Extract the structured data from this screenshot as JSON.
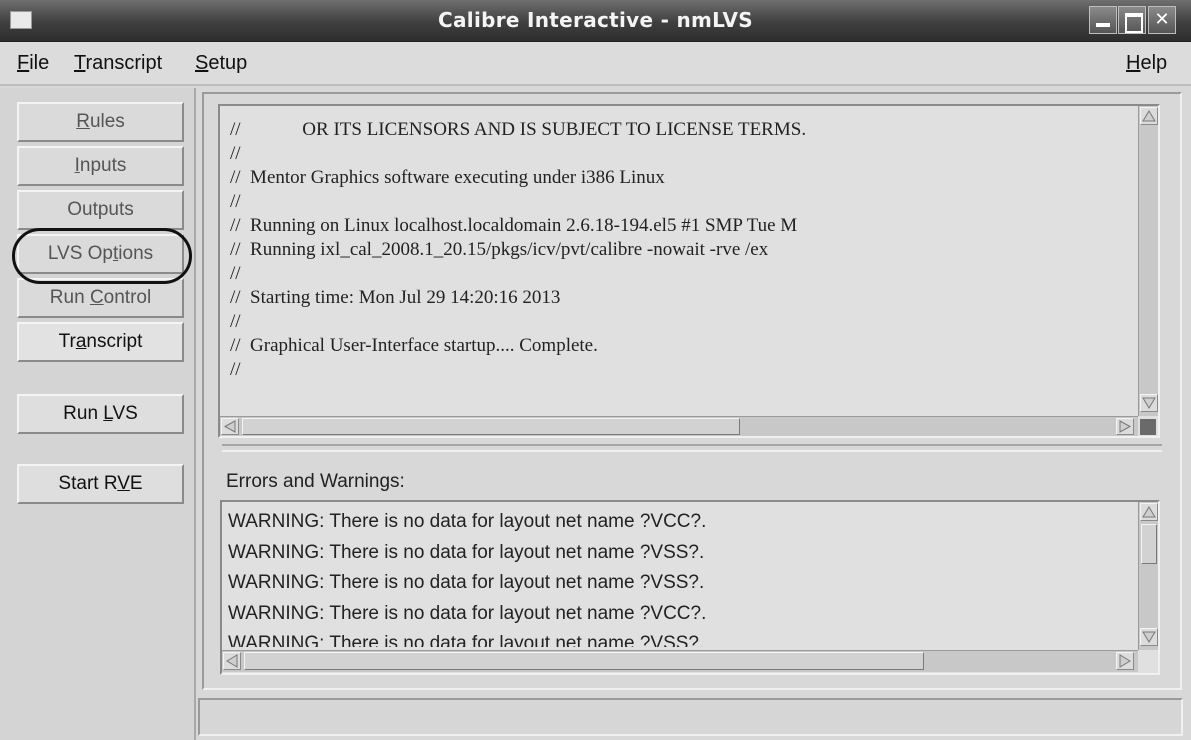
{
  "window": {
    "title": "Calibre Interactive - nmLVS"
  },
  "menubar": {
    "file": {
      "accel": "F",
      "rest": "ile"
    },
    "transcript": {
      "accel": "T",
      "rest": "ranscript"
    },
    "setup": {
      "accel": "S",
      "rest": "etup"
    },
    "help": {
      "accel": "H",
      "rest": "elp"
    }
  },
  "sidebar": {
    "rules": {
      "accel": "R",
      "rest": "ules"
    },
    "inputs": {
      "accel": "I",
      "rest": "nputs"
    },
    "outputs": "Outputs",
    "lvs_options": {
      "pre": "LVS Op",
      "accel": "t",
      "rest": "ions"
    },
    "run_control": {
      "pre": "Run ",
      "accel": "C",
      "rest": "ontrol"
    },
    "transcript": {
      "pre": "Tr",
      "accel": "a",
      "rest": "nscript"
    },
    "run_lvs": {
      "pre": "Run ",
      "accel": "L",
      "rest": "VS"
    },
    "start_rve": {
      "pre": "Start R",
      "accel": "V",
      "rest": "E"
    }
  },
  "transcript": {
    "lines": [
      "//             OR ITS LICENSORS AND IS SUBJECT TO LICENSE TERMS.",
      "//",
      "//  Mentor Graphics software executing under i386 Linux",
      "//",
      "//  Running on Linux localhost.localdomain 2.6.18-194.el5 #1 SMP Tue M",
      "//  Running ixl_cal_2008.1_20.15/pkgs/icv/pvt/calibre -nowait -rve /ex",
      "//",
      "//  Starting time: Mon Jul 29 14:20:16 2013",
      "//",
      "//  Graphical User-Interface startup.... Complete.",
      "//"
    ]
  },
  "errors": {
    "label": "Errors and Warnings:",
    "items": [
      "WARNING: There is no data for layout net name ?VCC?.",
      "WARNING: There is no data for layout net name ?VSS?.",
      "WARNING: There is no data for layout net name ?VSS?.",
      "WARNING: There is no data for layout net name ?VCC?.",
      "WARNING: There is no data for layout net name ?VSS?."
    ]
  }
}
